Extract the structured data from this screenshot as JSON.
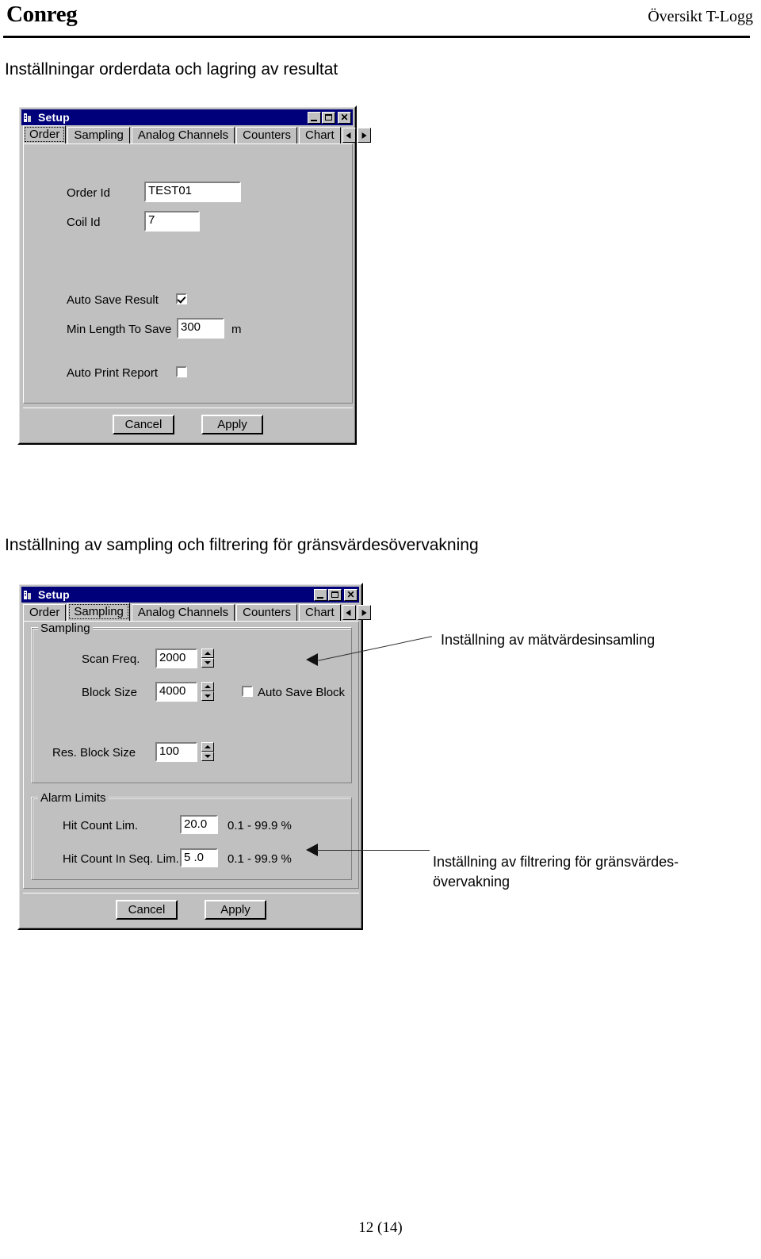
{
  "header": {
    "brand": "Conreg",
    "doc_title": "Översikt T-Logg"
  },
  "sections": [
    {
      "heading": "Inställningar orderdata och lagring av resultat"
    },
    {
      "heading": "Inställning av sampling och filtrering för gränsvärdesövervakning"
    }
  ],
  "dialog_order": {
    "title": "Setup",
    "title_icon": "setup-app-icon",
    "window_buttons": {
      "minimize": "minimize-icon",
      "maximize": "maximize-icon",
      "close": "close-icon",
      "close_glyph": "✕"
    },
    "tabs": [
      {
        "label": "Order",
        "active": true
      },
      {
        "label": "Sampling",
        "active": false
      },
      {
        "label": "Analog Channels",
        "active": false
      },
      {
        "label": "Counters",
        "active": false
      },
      {
        "label": "Chart",
        "active": false
      }
    ],
    "tab_scroll": {
      "prev": "chevron-left-icon",
      "next": "chevron-right-icon"
    },
    "fields": {
      "order_id_label": "Order Id",
      "order_id_value": "TEST01",
      "coil_id_label": "Coil Id",
      "coil_id_value": "7",
      "auto_save_result_label": "Auto Save Result",
      "auto_save_result_checked": true,
      "min_length_label": "Min Length To Save",
      "min_length_value": "300",
      "min_length_unit": "m",
      "auto_print_label": "Auto Print Report",
      "auto_print_checked": false
    },
    "buttons": {
      "cancel": "Cancel",
      "apply": "Apply"
    }
  },
  "dialog_sampling": {
    "title": "Setup",
    "title_icon": "setup-app-icon",
    "window_buttons": {
      "minimize": "minimize-icon",
      "maximize": "maximize-icon",
      "close": "close-icon",
      "close_glyph": "✕"
    },
    "tabs": [
      {
        "label": "Order",
        "active": false
      },
      {
        "label": "Sampling",
        "active": true
      },
      {
        "label": "Analog Channels",
        "active": false
      },
      {
        "label": "Counters",
        "active": false
      },
      {
        "label": "Chart",
        "active": false
      }
    ],
    "tab_scroll": {
      "prev": "chevron-left-icon",
      "next": "chevron-right-icon"
    },
    "sampling_group": {
      "legend": "Sampling",
      "scan_freq_label": "Scan Freq.",
      "scan_freq_value": "2000",
      "block_size_label": "Block Size",
      "block_size_value": "4000",
      "auto_save_block_label": "Auto Save Block",
      "auto_save_block_checked": false,
      "res_block_size_label": "Res. Block Size",
      "res_block_size_value": "100"
    },
    "alarm_group": {
      "legend": "Alarm Limits",
      "hit_count_label": "Hit Count Lim.",
      "hit_count_value": "20.0",
      "hit_count_range": "0.1 - 99.9 %",
      "hit_count_seq_label": "Hit Count In Seq. Lim.",
      "hit_count_seq_value": "5 .0",
      "hit_count_seq_range": "0.1 - 99.9 %"
    },
    "buttons": {
      "cancel": "Cancel",
      "apply": "Apply"
    }
  },
  "annotations": [
    {
      "text": "Inställning av mätvärdesinsamling"
    },
    {
      "text": "Inställning av filtrering för gränsvärdes-övervakning"
    }
  ],
  "footer": {
    "page": "12 (14)"
  }
}
